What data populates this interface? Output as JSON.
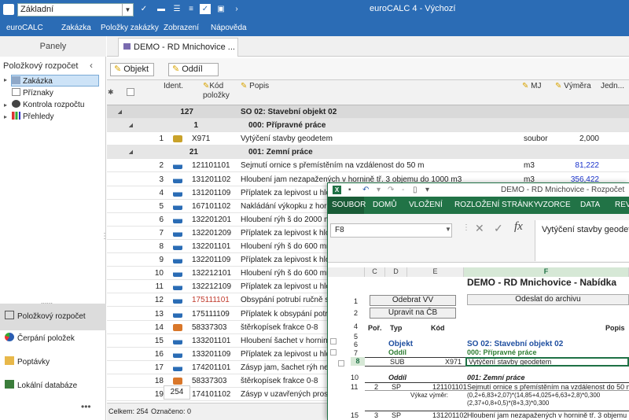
{
  "app": {
    "title": "euroCALC 4 - Výchozí",
    "template": "Základní"
  },
  "menu": [
    "euroCALC",
    "Zakázka",
    "Položky zakázky",
    "Zobrazení",
    "Nápověda"
  ],
  "left": {
    "panels_title": "Panely",
    "tree_title": "Položkový rozpočet",
    "tree": [
      {
        "label": "Zakázka",
        "icon": "table-icon",
        "selected": true
      },
      {
        "label": "Příznaky",
        "icon": "flag-icon"
      },
      {
        "label": "Kontrola rozpočtu",
        "icon": "check-icon"
      },
      {
        "label": "Přehledy",
        "icon": "bar-chart-icon"
      }
    ],
    "nav": [
      {
        "label": "Položkový rozpočet",
        "icon": "budget-icon",
        "active": true
      },
      {
        "label": "Čerpání položek",
        "icon": "pie-icon"
      },
      {
        "label": "Poptávky",
        "icon": "folder-icon"
      },
      {
        "label": "Lokální databáze",
        "icon": "database-icon"
      }
    ]
  },
  "tab": {
    "label": "DEMO - RD Mnichovice ..."
  },
  "group_buttons": [
    "Objekt",
    "Oddíl"
  ],
  "grid": {
    "headers": {
      "ident": "Ident.",
      "kod": "Kód položky",
      "popis": "Popis",
      "mj": "MJ",
      "vymera": "Výměra",
      "jedn": "Jedn..."
    },
    "rows": [
      {
        "type": "grp1",
        "ident": "127",
        "popis": "SO 02: Stavební objekt 02"
      },
      {
        "type": "grp2",
        "ident": "1",
        "popis": "000: Přípravné práce"
      },
      {
        "type": "item",
        "n": "1",
        "icon": "truck-icon",
        "kod": "X971",
        "popis": "Vytýčení stavby geodetem",
        "mj": "soubor",
        "vymera": "2,000"
      },
      {
        "type": "grp2",
        "ident": "21",
        "popis": "001: Zemní práce"
      },
      {
        "type": "item",
        "n": "2",
        "icon": "excavator-icon",
        "kod": "121101101",
        "popis": "Sejmutí ornice s přemístěním na vzdálenost do 50 m",
        "mj": "m3",
        "vymera": "81,222",
        "blue": true
      },
      {
        "type": "item",
        "n": "3",
        "icon": "excavator-icon",
        "kod": "131201102",
        "popis": "Hloubení jam nezapažených v hornině tř. 3 objemu do 1000 m3",
        "mj": "m3",
        "vymera": "356,422",
        "blue": true
      },
      {
        "type": "item",
        "n": "4",
        "icon": "excavator-icon",
        "kod": "131201109",
        "popis": "Příplatek za lepivost u hlou"
      },
      {
        "type": "item",
        "n": "5",
        "icon": "excavator-icon",
        "kod": "167101102",
        "popis": "Nakládání výkopku z hornin"
      },
      {
        "type": "item",
        "n": "6",
        "icon": "excavator-icon",
        "kod": "132201201",
        "popis": "Hloubení rýh š do 2000 mm"
      },
      {
        "type": "item",
        "n": "7",
        "icon": "excavator-icon",
        "kod": "132201209",
        "popis": "Příplatek za lepivost k hlo"
      },
      {
        "type": "item",
        "n": "8",
        "icon": "excavator-icon",
        "kod": "132201101",
        "popis": "Hloubení rýh š do 600 mm"
      },
      {
        "type": "item",
        "n": "9",
        "icon": "excavator-icon",
        "kod": "132201109",
        "popis": "Příplatek za lepivost k hlo"
      },
      {
        "type": "item",
        "n": "10",
        "icon": "excavator-icon",
        "kod": "132212101",
        "popis": "Hloubení rýh š do 600 mm"
      },
      {
        "type": "item",
        "n": "11",
        "icon": "excavator-icon",
        "kod": "132212109",
        "popis": "Příplatek za lepivost u hlou"
      },
      {
        "type": "item",
        "n": "12",
        "icon": "excavator-icon",
        "kod": "175111101",
        "popis": "Obsypání potrubí ručně sy",
        "red": true
      },
      {
        "type": "item",
        "n": "13",
        "icon": "excavator-icon",
        "kod": "175111109",
        "popis": "Příplatek k obsypání potrub"
      },
      {
        "type": "item",
        "n": "14",
        "icon": "brick-icon",
        "kod": "58337303",
        "popis": "štěrkopísek frakce 0-8"
      },
      {
        "type": "item",
        "n": "15",
        "icon": "excavator-icon",
        "kod": "133201101",
        "popis": "Hloubení šachet v hornině"
      },
      {
        "type": "item",
        "n": "16",
        "icon": "excavator-icon",
        "kod": "133201109",
        "popis": "Příplatek za lepivost u hlou"
      },
      {
        "type": "item",
        "n": "17",
        "icon": "excavator-icon",
        "kod": "174201101",
        "popis": "Zásyp jam, šachet rýh nebo"
      },
      {
        "type": "item",
        "n": "18",
        "icon": "brick-icon",
        "kod": "58337303",
        "popis": "štěrkopísek frakce 0-8"
      },
      {
        "type": "item",
        "n": "19",
        "icon": "excavator-icon",
        "kod": "174101102",
        "popis": "Zásyp v uzavřených prosto"
      }
    ],
    "total_box": "254",
    "footer": {
      "celkem": "Celkem: 254",
      "oznaceno": "Označeno: 0"
    }
  },
  "excel": {
    "title": "DEMO - RD Mnichovice - Rozpočet s výkazem",
    "tabs": [
      "SOUBOR",
      "DOMŮ",
      "VLOŽENÍ",
      "ROZLOŽENÍ STRÁNKY",
      "VZORCE",
      "DATA",
      "REVI"
    ],
    "namebox": "F8",
    "formula": "Vytýčení stavby geodetem",
    "cols": [
      "C",
      "D",
      "E",
      "F"
    ],
    "sheet_title": "DEMO - RD Mnichovice - Nabídka",
    "btn_odebrat": "Odebrat VV",
    "btn_upravit": "Upravit  na ČB",
    "btn_odeslat": "Odeslat do archivu",
    "hdr": {
      "por": "Poř.",
      "typ": "Typ",
      "kod": "Kód",
      "popis": "Popis"
    },
    "objekt": "Objekt",
    "oddil": "Oddíl",
    "so": "SO 02: Stavební objekt 02",
    "pripravne": "000: Přípravné práce",
    "r8": {
      "typ": "SUB",
      "kod": "X971",
      "popis": "Vytýčení stavby geodetem"
    },
    "zemni": "001: Zemní práce",
    "r11": {
      "por": "2",
      "typ": "SP",
      "kod": "121101101",
      "popis": "Sejmutí ornice s přemístěním na vzdálenost do 50 m"
    },
    "vykaz_label": "Výkaz výměr:",
    "vykaz1": "(0,2+6,83+2,07)*(14,85+4,025+6,63+2,8)*0,300",
    "vykaz2": "(2,37+0,8+0,5)*(8+3,3)*0,300",
    "r15": {
      "por": "3",
      "typ": "SP",
      "kod": "131201102",
      "popis": "Hloubení jam nezapažených v hornině tř. 3 objemu do 1000"
    }
  }
}
